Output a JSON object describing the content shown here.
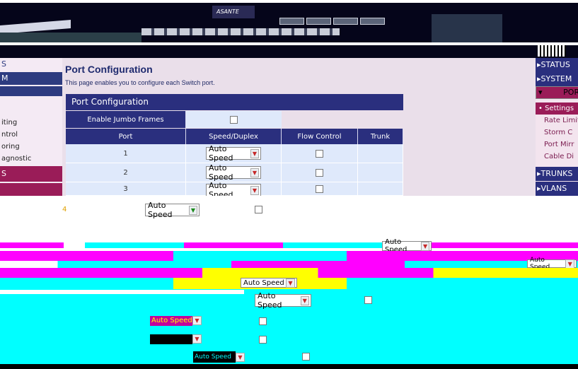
{
  "brand": {
    "logo_text": "ASANTE"
  },
  "left_nav": {
    "headers": [
      "S",
      "M",
      ""
    ],
    "items": [
      "iting",
      "ntrol",
      "oring",
      "agnostic"
    ],
    "bottom": "S"
  },
  "right_nav": {
    "status": "STATUS",
    "system": "SYSTEM",
    "ports": "PORTS",
    "items": [
      "Settings",
      "Rate Limit",
      "Storm C",
      "Port Mirr",
      "Cable Di"
    ],
    "trunks": "TRUNKS",
    "vlans": "VLANS"
  },
  "page": {
    "title": "Port Configuration",
    "description": "This page enables you to configure each Switch port.",
    "table_title": "Port Configuration",
    "jumbo_label": "Enable Jumbo Frames",
    "columns": [
      "Port",
      "Speed/Duplex",
      "Flow Control",
      "Trunk"
    ],
    "rows": [
      {
        "port": "1",
        "speed": "Auto Speed"
      },
      {
        "port": "2",
        "speed": "Auto Speed"
      },
      {
        "port": "3",
        "speed": "Auto Speed"
      },
      {
        "port": "4",
        "speed": "Auto Speed"
      }
    ],
    "extra_selects": [
      "Auto Speed",
      "Auto Speed",
      "Auto Speed",
      "Auto Speed",
      "Auto Speed",
      "Auto Speed"
    ]
  },
  "colors": {
    "nav_blue": "#2a2f7e",
    "magenta": "#9a1c58",
    "cell_blue": "#dfe9fb"
  }
}
